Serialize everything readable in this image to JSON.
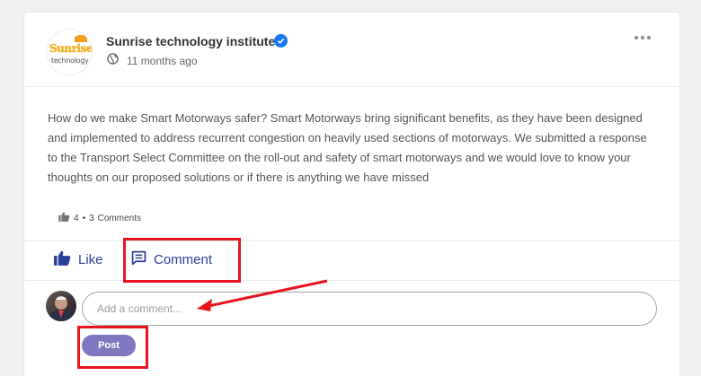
{
  "post": {
    "author": "Sunrise technology institute",
    "logo_text_top": "Sunrise",
    "logo_text_bottom": "technology",
    "verified": true,
    "time": "11 months ago",
    "visibility_icon": "globe-icon",
    "body": "How do we make Smart Motorways safer? Smart Motorways bring significant benefits, as they have been designed and implemented to address recurrent congestion on heavily used sections of motorways. We submitted a response to the Transport Select Committee on the roll-out and safety of smart motorways and we would love to know your thoughts on our proposed solutions or if there is anything we have missed",
    "reactions_count": "4",
    "separator": "•",
    "comments_count": "3",
    "comments_label": "Comments"
  },
  "actions": {
    "like_label": "Like",
    "comment_label": "Comment"
  },
  "comment_box": {
    "placeholder": "Add a comment...",
    "value": "",
    "post_label": "Post"
  },
  "colors": {
    "accent": "#2c3e9c",
    "post_button": "#7f78c0",
    "verified": "#1877f2",
    "annotation": "#e8141f"
  }
}
